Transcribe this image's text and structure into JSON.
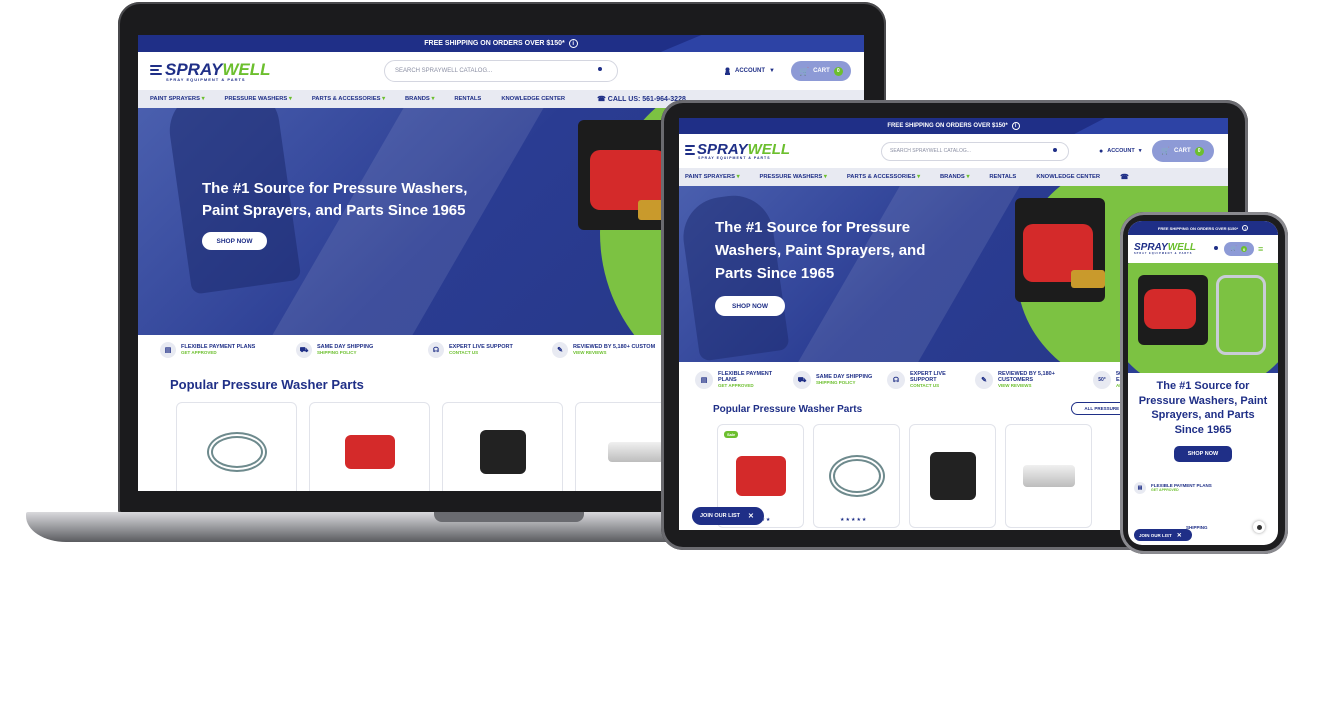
{
  "promo": {
    "text": "FREE SHIPPING ON ORDERS OVER $150*",
    "mobile_text": "FREE SHIPPING ON ORDERS OVER $150*",
    "info_icon": "i"
  },
  "brand": {
    "spray": "SPRAY",
    "well": "WELL",
    "tagline": "SPRAY EQUIPMENT & PARTS",
    "colors": {
      "navy": "#1f2f87",
      "green": "#6cbf2e"
    }
  },
  "search": {
    "placeholder": "SEARCH SPRAYWELL CATALOG..."
  },
  "account": {
    "label": "ACCOUNT"
  },
  "cart": {
    "label": "CART",
    "count": "0"
  },
  "nav": {
    "items": [
      "PAINT SPRAYERS",
      "PRESSURE WASHERS",
      "PARTS & ACCESSORIES",
      "BRANDS",
      "RENTALS",
      "KNOWLEDGE CENTER"
    ],
    "call": "CALL US: 561-964-3228"
  },
  "hero": {
    "laptop_line1": "The #1 Source for Pressure Washers,",
    "laptop_line2": "Paint Sprayers, and Parts Since 1965",
    "tablet_line1": "The #1 Source for Pressure",
    "tablet_line2": "Washers, Paint Sprayers, and",
    "tablet_line3": "Parts Since 1965",
    "phone_line1": "The #1 Source for",
    "phone_line2": "Pressure Washers, Paint",
    "phone_line3": "Sprayers, and Parts",
    "phone_line4": "Since 1965",
    "cta": "SHOP NOW"
  },
  "features": [
    {
      "title": "FLEXIBLE PAYMENT PLANS",
      "sub": "GET APPROVED",
      "icon": "document-icon"
    },
    {
      "title": "SAME DAY SHIPPING",
      "sub": "SHIPPING POLICY",
      "icon": "truck-icon"
    },
    {
      "title": "EXPERT LIVE SUPPORT",
      "sub": "CONTACT US",
      "icon": "headset-icon"
    },
    {
      "title": "REVIEWED BY 5,180+ CUSTOMERS",
      "sub": "VIEW REVIEWS",
      "icon": "review-icon"
    },
    {
      "title": "50",
      "sub": "",
      "icon": "badge-icon"
    }
  ],
  "laptop_features": [
    {
      "title": "FLEXIBLE PAYMENT PLANS",
      "sub": "GET APPROVED"
    },
    {
      "title": "SAME DAY SHIPPING",
      "sub": "SHIPPING POLICY"
    },
    {
      "title": "EXPERT LIVE SUPPORT",
      "sub": "CONTACT US"
    },
    {
      "title": "REVIEWED BY 5,180+ CUSTOM",
      "sub": "VIEW REVIEWS"
    }
  ],
  "tablet_features": [
    {
      "title1": "FLEXIBLE PAYMENT",
      "title2": "PLANS",
      "sub": "GET APPROVED"
    },
    {
      "title1": "SAME DAY SHIPPING",
      "title2": "",
      "sub": "SHIPPING POLICY"
    },
    {
      "title1": "EXPERT LIVE",
      "title2": "SUPPORT",
      "sub": "CONTACT US"
    },
    {
      "title1": "REVIEWED BY 5,180+",
      "title2": "CUSTOMERS",
      "sub": "VIEW REVIEWS"
    },
    {
      "title1": "50",
      "title2": "EX",
      "sub": "AB"
    }
  ],
  "popular": {
    "title": "Popular Pressure Washer Parts",
    "view_all": "ALL PRESSURE WA"
  },
  "sale_badge": "Sale",
  "stars": "★★★★★",
  "join": {
    "label": "JOIN OUR LIST"
  },
  "phone_feature": {
    "title": "FLEXIBLE PAYMENT PLANS",
    "sub": "GET APPROVED",
    "title2": "SHIPPING"
  }
}
